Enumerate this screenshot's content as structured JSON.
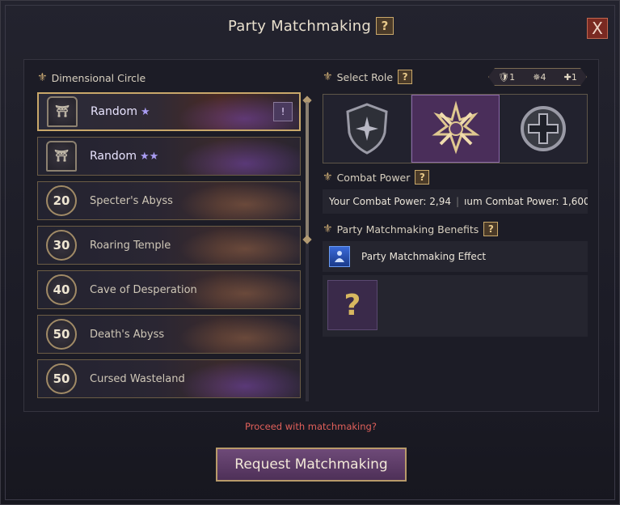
{
  "window": {
    "title": "Party Matchmaking",
    "help": "?",
    "close": "X"
  },
  "left": {
    "section_title": "Dimensional Circle",
    "items": [
      {
        "badge": "",
        "label": "Random",
        "stars": "★",
        "lock": "!"
      },
      {
        "badge": "",
        "label": "Random",
        "stars": "★★"
      },
      {
        "badge": "20",
        "label": "Specter's Abyss"
      },
      {
        "badge": "30",
        "label": "Roaring Temple"
      },
      {
        "badge": "40",
        "label": "Cave of Desperation"
      },
      {
        "badge": "50",
        "label": "Death's Abyss"
      },
      {
        "badge": "50",
        "label": "Cursed Wasteland"
      }
    ]
  },
  "right": {
    "role_title": "Select Role",
    "role_counts": {
      "tank": "1",
      "dps": "4",
      "healer": "1"
    },
    "roles": [
      "shield-role-icon",
      "swords-role-icon",
      "cross-role-icon"
    ],
    "combat_title": "Combat Power",
    "your_cp": "Your Combat Power: 2,94",
    "min_cp": "ıum Combat Power: 1,600",
    "benefits_title": "Party Matchmaking Benefits",
    "benefit_effect": "Party Matchmaking Effect",
    "mystery": "?"
  },
  "footer": {
    "prompt": "Proceed with matchmaking?",
    "button": "Request Matchmaking"
  },
  "colors": {
    "accent": "#c9a86a",
    "selected_role": "#4a2e5a",
    "prompt": "#e0605a"
  }
}
